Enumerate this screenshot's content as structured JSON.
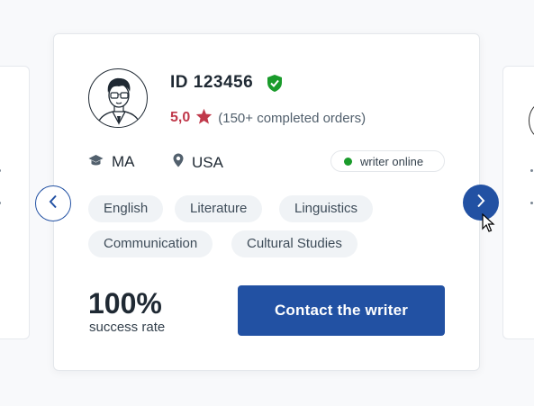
{
  "writer": {
    "id_label": "ID 123456",
    "rating": "5,0",
    "orders": "(150+ completed orders)",
    "degree": "MA",
    "country": "USA",
    "status": "writer online",
    "subjects": [
      "English",
      "Literature",
      "Linguistics",
      "Communication",
      "Cultural Studies"
    ],
    "success_rate": "100%",
    "success_label": "success rate",
    "contact_label": "Contact the writer"
  },
  "colors": {
    "accent": "#2251a3",
    "rating": "#c0394b",
    "online": "#1a9b2b",
    "verified": "#1a9b2b"
  },
  "icons": {
    "verified": "shield-check-icon",
    "rating": "star-icon",
    "degree": "graduation-cap-icon",
    "location": "map-pin-icon",
    "prev": "chevron-left-icon",
    "next": "chevron-right-icon"
  }
}
